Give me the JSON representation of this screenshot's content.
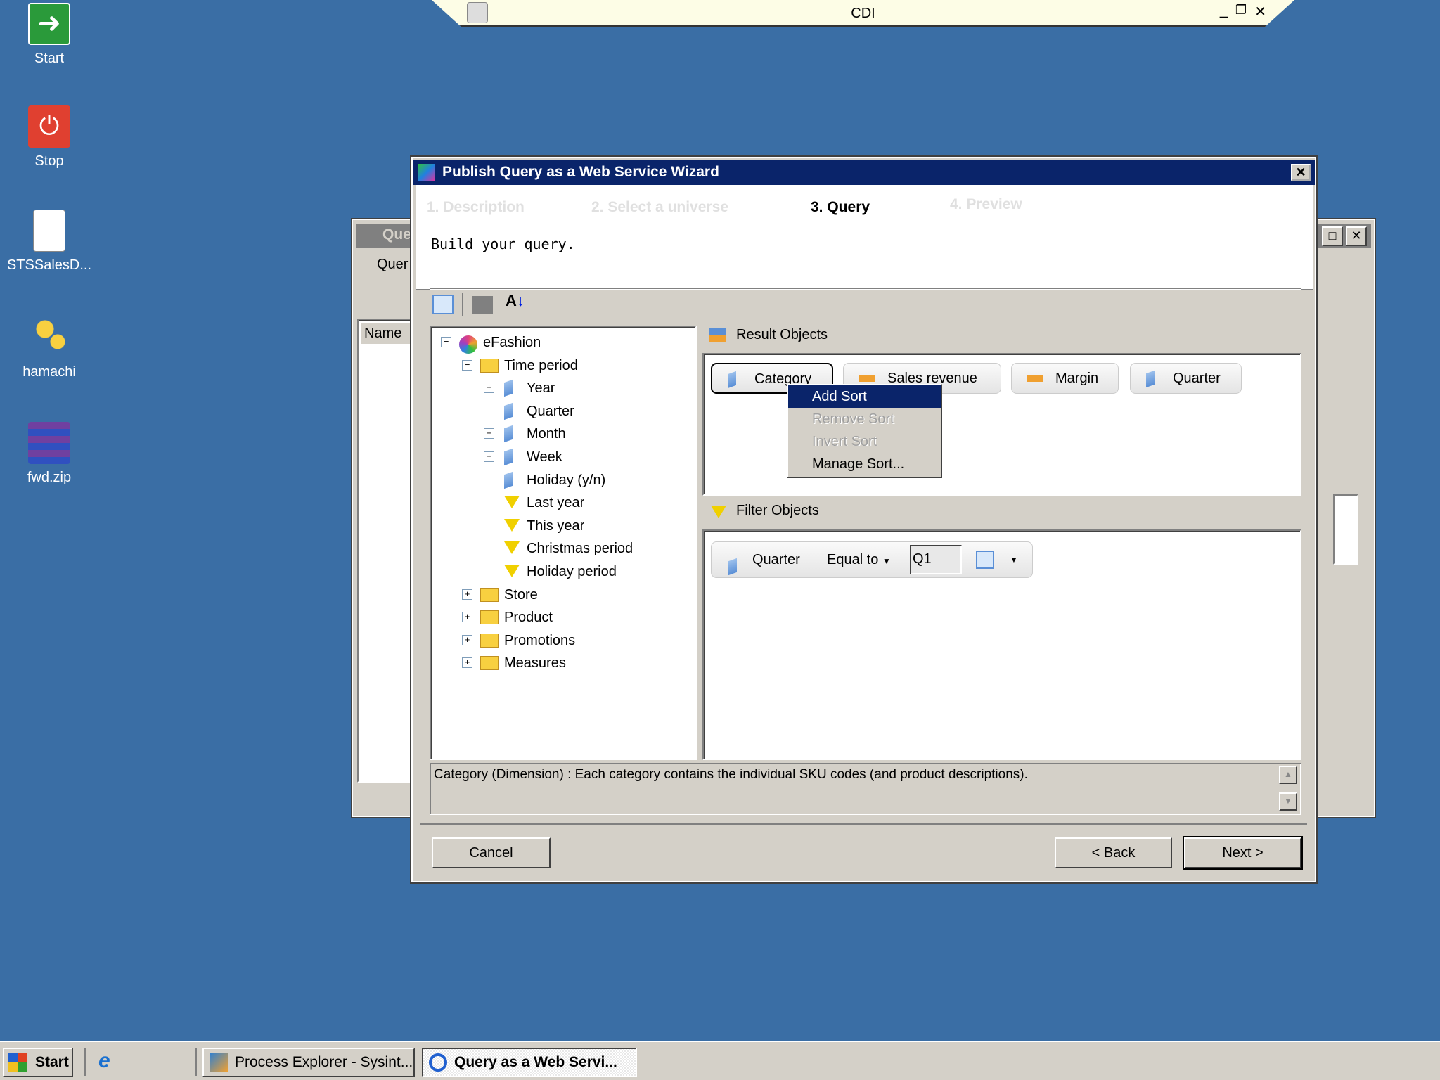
{
  "desktop": {
    "icons": [
      {
        "label": "Start"
      },
      {
        "label": "Stop"
      },
      {
        "label": "STSSalesD..."
      },
      {
        "label": "hamachi"
      },
      {
        "label": "fwd.zip"
      }
    ]
  },
  "cdi_bar": {
    "title": "CDI"
  },
  "background_window": {
    "title": "Que",
    "menu": "Quer",
    "column": "Name"
  },
  "wizard": {
    "title": "Publish Query as a Web Service Wizard",
    "steps": [
      "1. Description",
      "2. Select a universe",
      "3. Query",
      "4. Preview"
    ],
    "active_step": 2,
    "subtitle": "Build your query.",
    "tree": [
      {
        "label": "eFashion",
        "level": 0,
        "icon": "universe",
        "exp": "-"
      },
      {
        "label": "Time period",
        "level": 1,
        "icon": "folder",
        "exp": "-"
      },
      {
        "label": "Year",
        "level": 2,
        "icon": "dimension",
        "exp": "+"
      },
      {
        "label": "Quarter",
        "level": 2,
        "icon": "dimension",
        "exp": ""
      },
      {
        "label": "Month",
        "level": 2,
        "icon": "dimension",
        "exp": "+"
      },
      {
        "label": "Week",
        "level": 2,
        "icon": "dimension",
        "exp": "+"
      },
      {
        "label": "Holiday (y/n)",
        "level": 2,
        "icon": "dimension",
        "exp": ""
      },
      {
        "label": "Last year",
        "level": 2,
        "icon": "filter",
        "exp": ""
      },
      {
        "label": "This year",
        "level": 2,
        "icon": "filter",
        "exp": ""
      },
      {
        "label": "Christmas period",
        "level": 2,
        "icon": "filter",
        "exp": ""
      },
      {
        "label": "Holiday period",
        "level": 2,
        "icon": "filter",
        "exp": ""
      },
      {
        "label": "Store",
        "level": 1,
        "icon": "folder",
        "exp": "+"
      },
      {
        "label": "Product",
        "level": 1,
        "icon": "folder",
        "exp": "+"
      },
      {
        "label": "Promotions",
        "level": 1,
        "icon": "folder",
        "exp": "+"
      },
      {
        "label": "Measures",
        "level": 1,
        "icon": "folder",
        "exp": "+"
      }
    ],
    "result_label": "Result Objects",
    "result_objects": [
      {
        "label": "Category",
        "icon": "dimension"
      },
      {
        "label": "Sales revenue",
        "icon": "measure"
      },
      {
        "label": "Margin",
        "icon": "measure"
      },
      {
        "label": "Quarter",
        "icon": "dimension"
      }
    ],
    "context_menu": [
      {
        "label": "Add Sort",
        "state": "selected"
      },
      {
        "label": "Remove Sort",
        "state": "disabled"
      },
      {
        "label": "Invert Sort",
        "state": "disabled"
      },
      {
        "label": "Manage Sort...",
        "state": "normal"
      }
    ],
    "filter_label": "Filter Objects",
    "filter": {
      "object": "Quarter",
      "operator": "Equal to",
      "value": "Q1"
    },
    "description": "Category (Dimension) : Each category contains the individual SKU codes (and product descriptions).",
    "buttons": {
      "cancel": "Cancel",
      "back": "< Back",
      "next": "Next >"
    }
  },
  "taskbar": {
    "start": "Start",
    "items": [
      "Process Explorer - Sysint...",
      "Query as a Web Servi..."
    ]
  }
}
